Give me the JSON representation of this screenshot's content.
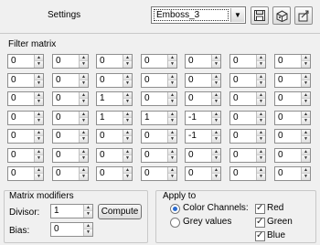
{
  "header": {
    "settings_label": "Settings",
    "preset_value": "Emboss_3",
    "icons": [
      "save-icon",
      "load-preset-icon",
      "load-file-icon"
    ]
  },
  "filter_matrix": {
    "title": "Filter matrix",
    "rows": [
      [
        "0",
        "0",
        "0",
        "0",
        "0",
        "0",
        "0"
      ],
      [
        "0",
        "0",
        "0",
        "0",
        "0",
        "0",
        "0"
      ],
      [
        "0",
        "0",
        "1",
        "0",
        "0",
        "0",
        "0"
      ],
      [
        "0",
        "0",
        "1",
        "1",
        "-1",
        "0",
        "0"
      ],
      [
        "0",
        "0",
        "0",
        "0",
        "-1",
        "0",
        "0"
      ],
      [
        "0",
        "0",
        "0",
        "0",
        "0",
        "0",
        "0"
      ],
      [
        "0",
        "0",
        "0",
        "0",
        "0",
        "0",
        "0"
      ]
    ]
  },
  "matrix_modifiers": {
    "title": "Matrix modifiers",
    "divisor_label": "Divisor:",
    "divisor_value": "1",
    "compute_label": "Compute",
    "bias_label": "Bias:",
    "bias_value": "0"
  },
  "apply_to": {
    "title": "Apply to",
    "color_channels_label": "Color Channels:",
    "grey_values_label": "Grey values",
    "selected": "color_channels",
    "red_label": "Red",
    "green_label": "Green",
    "blue_label": "Blue",
    "red_checked": true,
    "green_checked": true,
    "blue_checked": true
  }
}
